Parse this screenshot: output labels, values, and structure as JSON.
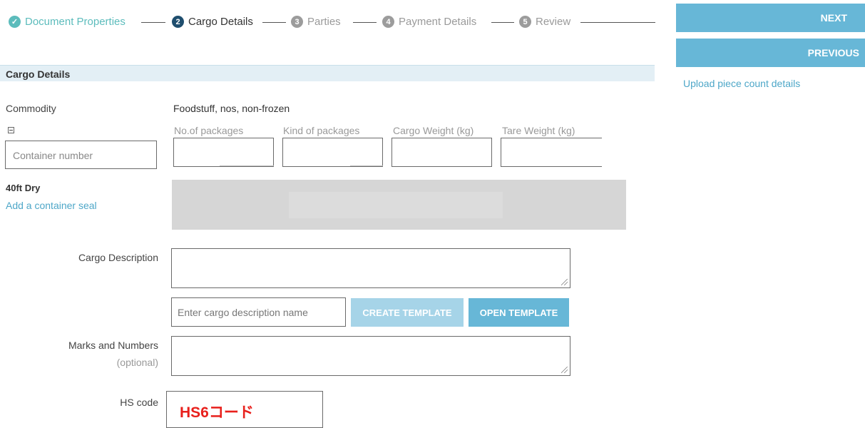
{
  "stepper": {
    "steps": [
      {
        "label": "Document Properties",
        "marker": "✓",
        "state": "done"
      },
      {
        "label": "Cargo Details",
        "marker": "2",
        "state": "active"
      },
      {
        "label": "Parties",
        "marker": "3",
        "state": "todo"
      },
      {
        "label": "Payment Details",
        "marker": "4",
        "state": "todo"
      },
      {
        "label": "Review",
        "marker": "5",
        "state": "todo"
      }
    ]
  },
  "actions": {
    "next_label": "NEXT",
    "previous_label": "PREVIOUS",
    "upload_link": "Upload piece count details"
  },
  "section": {
    "title": "Cargo Details"
  },
  "commodity": {
    "label": "Commodity",
    "value": "Foodstuff, nos, non-frozen"
  },
  "container": {
    "collapse_icon": "minus-square-icon",
    "number_placeholder": "Container number",
    "type": "40ft Dry",
    "add_seal_link": "Add a container seal"
  },
  "columns": {
    "packages_count": "No.of packages",
    "packages_kind": "Kind of packages",
    "cargo_weight": "Cargo Weight (kg)",
    "tare_weight": "Tare Weight (kg)"
  },
  "cargo_description": {
    "label": "Cargo Description",
    "value": "",
    "template_name_placeholder": "Enter cargo description name",
    "create_template_label": "CREATE TEMPLATE",
    "open_template_label": "OPEN TEMPLATE"
  },
  "marks": {
    "label": "Marks and Numbers",
    "optional": "(optional)",
    "value": ""
  },
  "hs_code": {
    "label": "HS code",
    "value": "HS6コード",
    "value_color": "#e8201c"
  },
  "colors": {
    "accent": "#67b7d7",
    "done": "#5cbcbc",
    "active": "#1f4e6e",
    "disabled_button": "#a6d4e8"
  }
}
